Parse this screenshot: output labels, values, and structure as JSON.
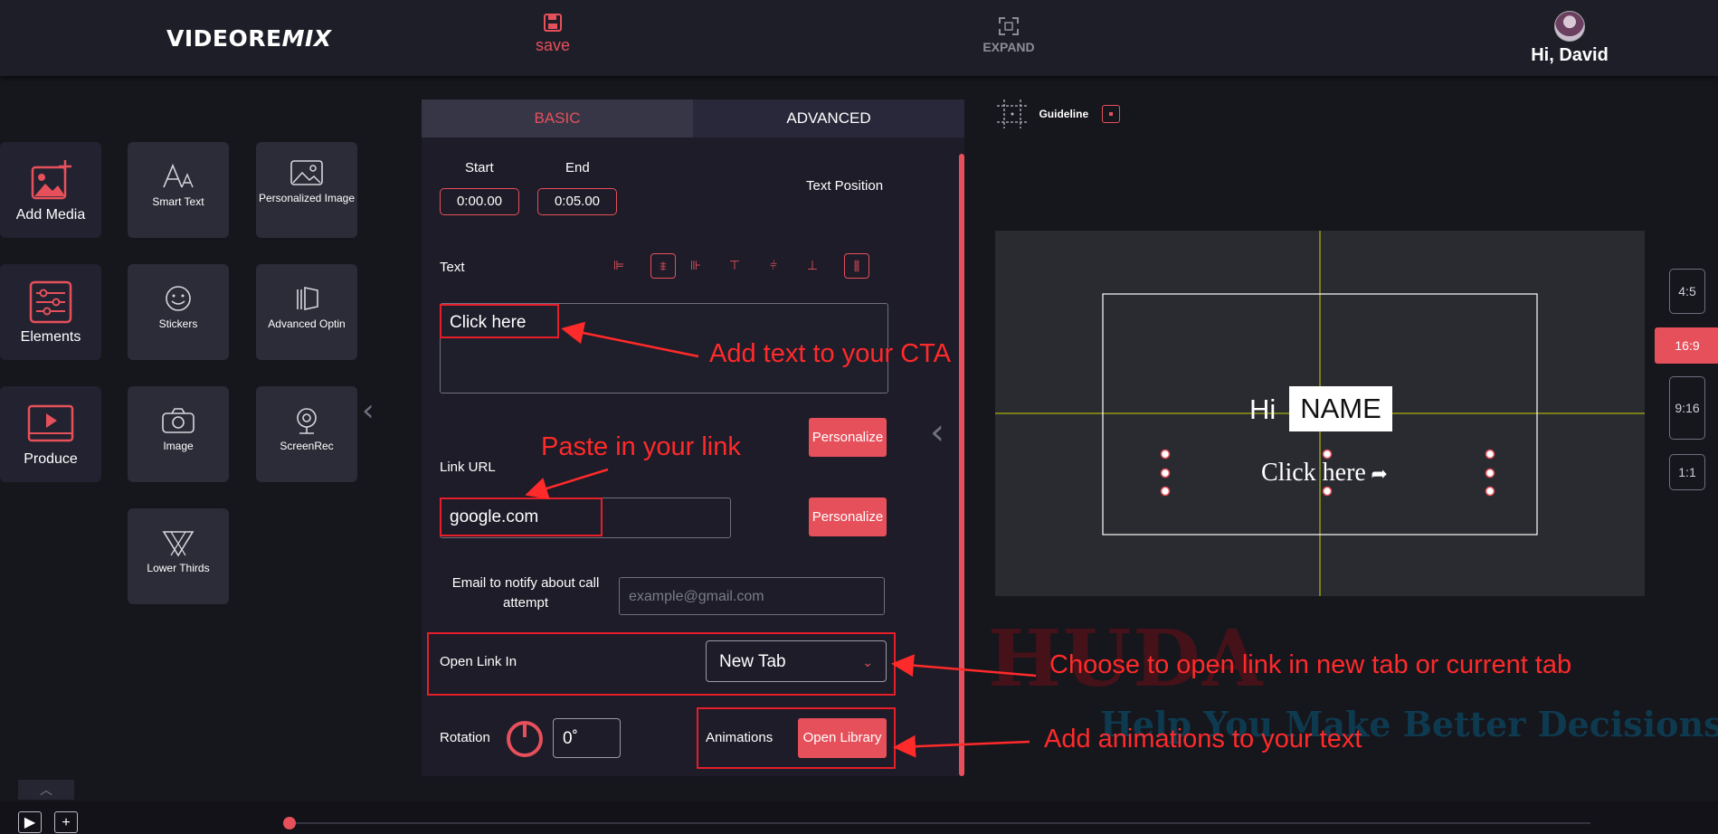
{
  "header": {
    "logo_left": "VIDEORE",
    "logo_right": "MIX",
    "save_label": "save",
    "expand_label": "EXPAND",
    "greeting": "Hi, David"
  },
  "left_tools": {
    "main": [
      {
        "label": "Add Media",
        "icon": "add-media-icon"
      },
      {
        "label": "Elements",
        "icon": "sliders-icon"
      },
      {
        "label": "Produce",
        "icon": "play-screen-icon"
      }
    ],
    "tiles": [
      {
        "label": "Smart Text",
        "icon": "text-icon"
      },
      {
        "label": "Personalized Image",
        "icon": "image-icon"
      },
      {
        "label": "Stickers",
        "icon": "smiley-icon"
      },
      {
        "label": "Advanced Optin",
        "icon": "optin-icon"
      },
      {
        "label": "Image",
        "icon": "camera-icon"
      },
      {
        "label": "ScreenRec",
        "icon": "webcam-icon"
      },
      {
        "label": "Lower Thirds",
        "icon": "lower-thirds-icon"
      }
    ]
  },
  "panel": {
    "tabs": {
      "basic": "BASIC",
      "advanced": "ADVANCED"
    },
    "start_label": "Start",
    "end_label": "End",
    "start_value": "0:00.00",
    "end_value": "0:05.00",
    "text_position_label": "Text Position",
    "text_label": "Text",
    "text_value": "Click here",
    "personalize_label": "Personalize",
    "link_url_label": "Link URL",
    "link_value": "google.com",
    "email_label_1": "Email to notify about call",
    "email_label_2": "attempt",
    "email_placeholder": "example@gmail.com",
    "open_link_label": "Open Link In",
    "open_link_value": "New Tab",
    "rotation_label": "Rotation",
    "rotation_value": "0˚",
    "animations_label": "Animations",
    "open_library_label": "Open Library"
  },
  "preview": {
    "guideline_label": "Guideline",
    "canvas_hi": "Hi",
    "canvas_name": "NAME",
    "canvas_cta": "Click here",
    "aspect_ratios": [
      "4:5",
      "16:9",
      "9:16",
      "1:1"
    ],
    "active_ratio": "16:9"
  },
  "annotations": {
    "cta": "Add text to your CTA",
    "link": "Paste in your link",
    "open": "Choose to open link in new tab or current tab",
    "anim": "Add animations to your text"
  },
  "watermark": {
    "brand": "HUDA",
    "slogan": "Help You Make Better Decisions"
  },
  "colors": {
    "accent": "#e6505b",
    "annotation": "#ff2a2a",
    "guide": "#c8d400"
  }
}
